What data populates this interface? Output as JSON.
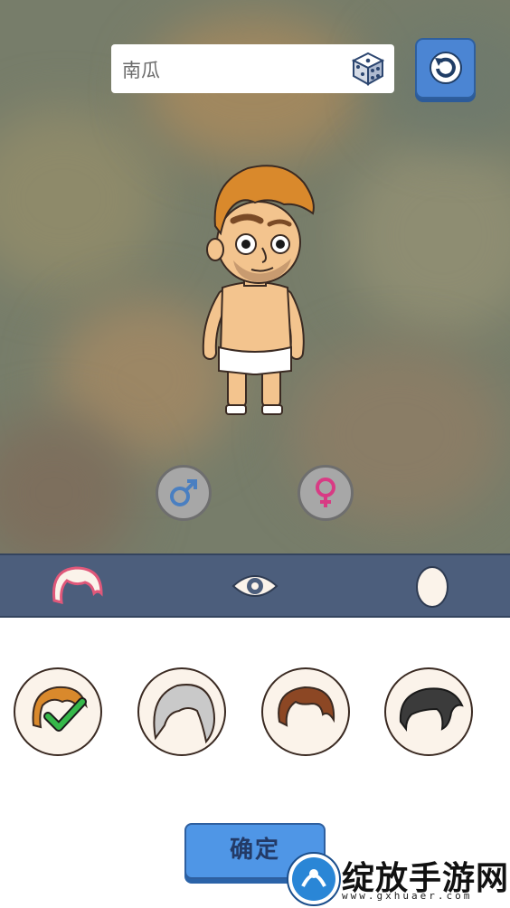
{
  "player": {
    "name": "南瓜"
  },
  "icons": {
    "dice": "dice-icon",
    "reset": "refresh-icon",
    "male": "male-symbol-icon",
    "female": "female-symbol-icon",
    "tab_hair": "hair-icon",
    "tab_eyes": "eye-icon",
    "tab_face": "face-icon",
    "selected": "checkmark-icon"
  },
  "tabs": [
    {
      "id": "hair",
      "active": true
    },
    {
      "id": "eyes",
      "active": false
    },
    {
      "id": "face",
      "active": false
    }
  ],
  "hair_options": [
    {
      "style": "orange-quiff",
      "color": "#d9892c",
      "selected": true
    },
    {
      "style": "long-grey",
      "color": "#c9c9c9",
      "selected": false
    },
    {
      "style": "brown-messy",
      "color": "#8c4724",
      "selected": false
    },
    {
      "style": "black-slicked",
      "color": "#3b3b3b",
      "selected": false
    }
  ],
  "confirm_label": "确定",
  "watermark": {
    "title": "绽放手游网",
    "url": "www.gxhuaer.com"
  },
  "colors": {
    "accent_blue": "#4b85d3",
    "tabbar": "#4c5e7c",
    "male": "#4a7fc1",
    "female": "#d83b84"
  }
}
